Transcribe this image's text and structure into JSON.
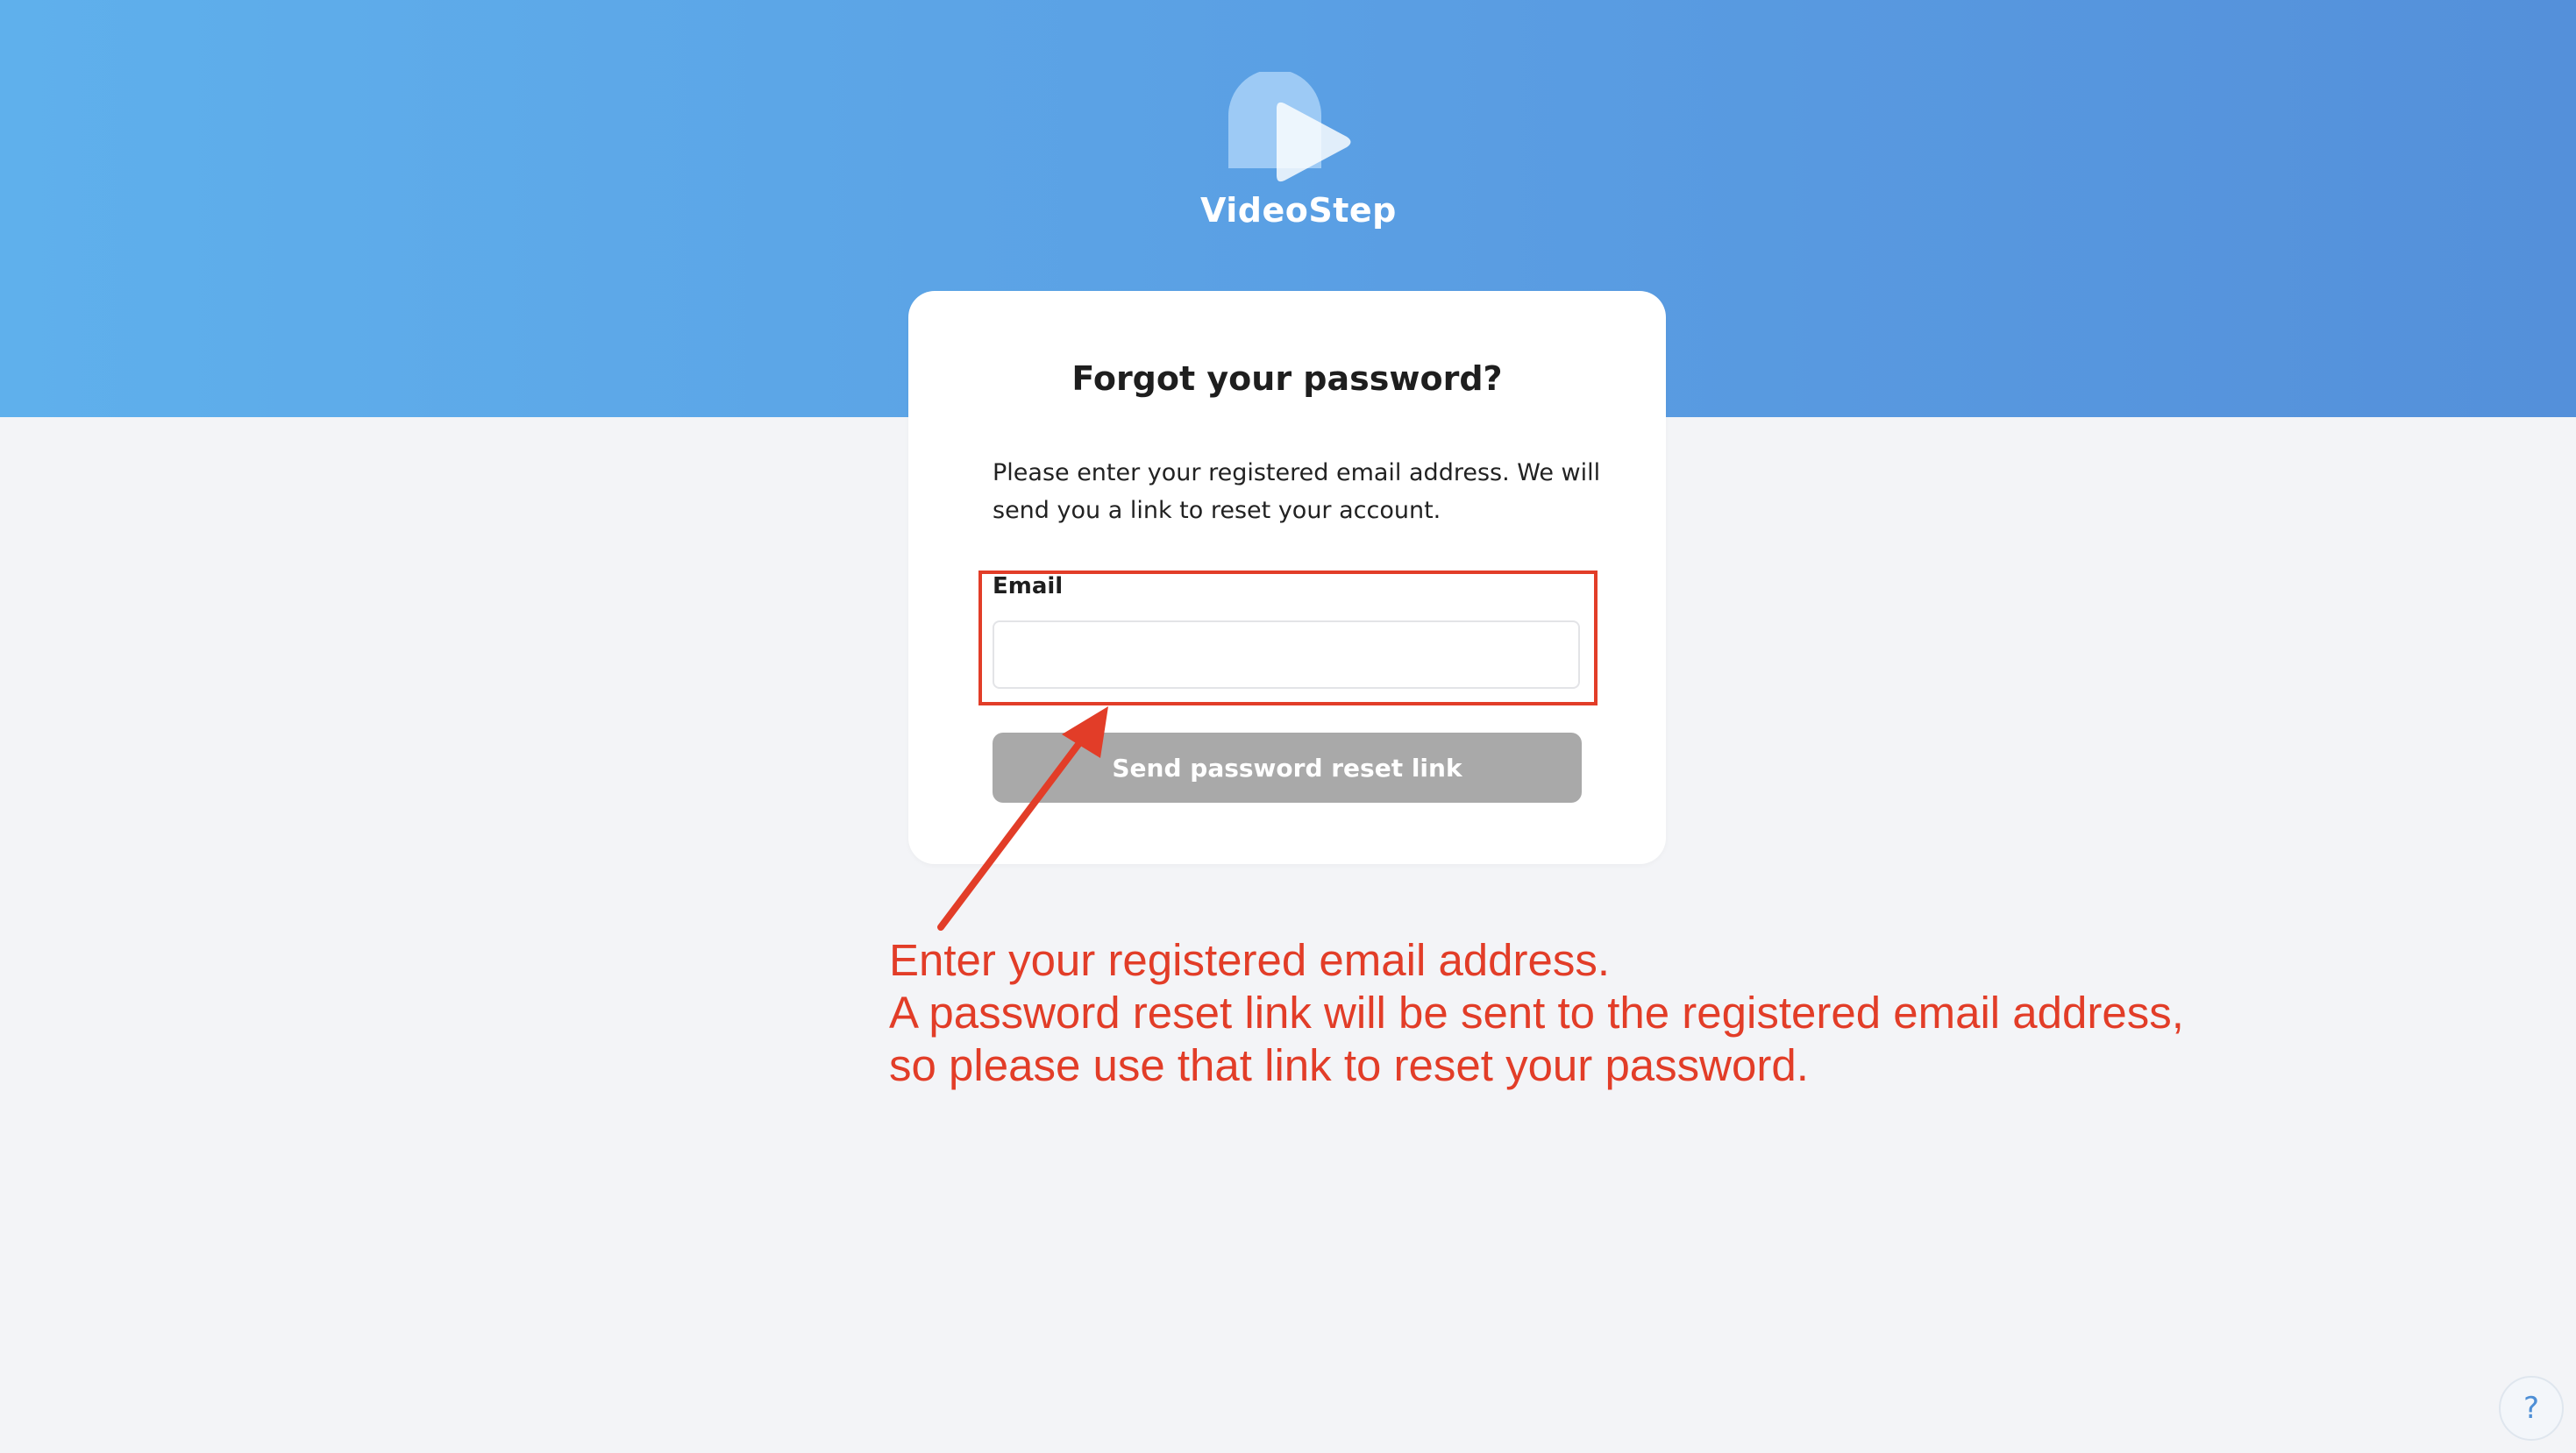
{
  "brand": {
    "name": "VideoStep"
  },
  "card": {
    "title": "Forgot your password?",
    "description": "Please enter your registered email address. We will send you a link to reset your account.",
    "email_label": "Email",
    "email_value": "",
    "email_placeholder": "",
    "submit_label": "Send password reset link"
  },
  "annotation": {
    "lines": [
      "Enter your registered email address.",
      "A password reset link will be sent to the registered email address,",
      "so please use that link to reset your password."
    ]
  },
  "help": {
    "label": "?"
  },
  "colors": {
    "banner_start": "#5fb0ec",
    "banner_end": "#5490da",
    "annotation_red": "#e23d28",
    "button_disabled": "#a9a9a9"
  },
  "icons": {
    "logo": "videostep-play-logo",
    "help": "question-mark-icon"
  }
}
